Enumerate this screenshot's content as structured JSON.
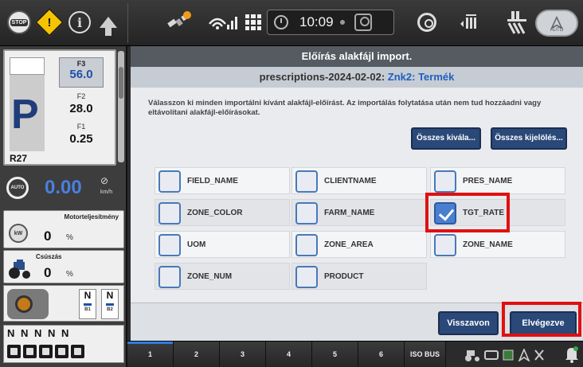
{
  "topbar": {
    "stop_label": "STOP",
    "warning_icon": "warning-icon",
    "info_icon": "info-icon",
    "time": "10:09",
    "auto_label": "AUTO"
  },
  "left_panel": {
    "gears": {
      "f3_label": "F3",
      "f3_value": "56.0",
      "f2_label": "F2",
      "f2_value": "28.0",
      "f1_label": "F1",
      "f1_value": "0.25",
      "park": "P",
      "range": "R27"
    },
    "speed": {
      "auto_label": "AUTO",
      "value": "0.00",
      "unit": "km/h"
    },
    "engine_power": {
      "title": "Motorteljesítmény",
      "icon_label": "kW",
      "value": "0",
      "unit": "%"
    },
    "slip": {
      "title": "Csúszás",
      "value": "0",
      "unit": "%"
    },
    "hitch": {
      "b1_state": "N",
      "b1_label": "B1",
      "b2_state": "N",
      "b2_label": "B2"
    },
    "valves": "N N N N N"
  },
  "dialog": {
    "title": "Előírás alakfájl import.",
    "subtitle_file": "prescriptions-2024-02-02:",
    "subtitle_target": "Znk2: Termék",
    "instructions": "Válasszon ki minden importálni kívánt alakfájl-előírást. Az importálás folytatása után nem tud hozzáadni vagy eltávolítani alakfájl-előírásokat.",
    "deselect_all": "Összes kivála...",
    "select_all": "Összes kijelölés...",
    "fields": [
      {
        "label": "FIELD_NAME",
        "checked": false
      },
      {
        "label": "CLIENTNAME",
        "checked": false
      },
      {
        "label": "PRES_NAME",
        "checked": false
      },
      {
        "label": "ZONE_COLOR",
        "checked": false
      },
      {
        "label": "FARM_NAME",
        "checked": false
      },
      {
        "label": "TGT_RATE",
        "checked": true
      },
      {
        "label": "UOM",
        "checked": false
      },
      {
        "label": "ZONE_AREA",
        "checked": false
      },
      {
        "label": "ZONE_NAME",
        "checked": false
      },
      {
        "label": "ZONE_NUM",
        "checked": false
      },
      {
        "label": "PRODUCT",
        "checked": false
      }
    ],
    "cancel": "Visszavon",
    "done": "Elvégezve",
    "highlight_color": "#e01010"
  },
  "bottombar": {
    "tabs": [
      "1",
      "2",
      "3",
      "4",
      "5",
      "6",
      "ISO BUS"
    ]
  }
}
